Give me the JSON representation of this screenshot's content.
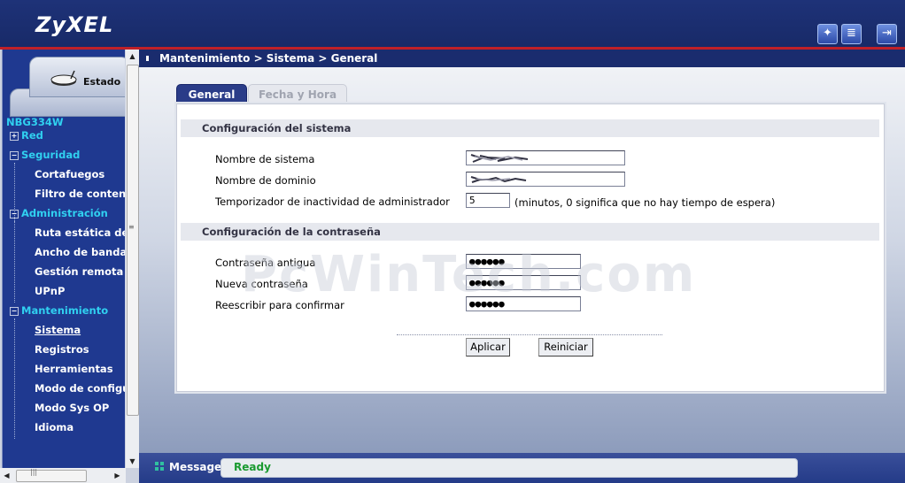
{
  "header": {
    "logo": "ZyXEL",
    "tools": [
      {
        "icon": "wizard-icon",
        "glyph": "✦"
      },
      {
        "icon": "notes-icon",
        "glyph": "≣"
      },
      {
        "icon": "logout-icon",
        "glyph": "⇥"
      }
    ]
  },
  "sidebar": {
    "tab_label": "Estado",
    "device": "NBG334W",
    "menu": [
      {
        "label": "Red",
        "type": "top",
        "sign": "+"
      },
      {
        "label": "Seguridad",
        "type": "top",
        "sign": "−"
      },
      {
        "label": "Cortafuegos",
        "type": "sub"
      },
      {
        "label": "Filtro de conten",
        "type": "sub"
      },
      {
        "label": "Administración",
        "type": "top",
        "sign": "−"
      },
      {
        "label": "Ruta estática de",
        "type": "sub"
      },
      {
        "label": "Ancho de banda",
        "type": "sub"
      },
      {
        "label": "Gestión remota",
        "type": "sub"
      },
      {
        "label": "UPnP",
        "type": "sub"
      },
      {
        "label": "Mantenimiento",
        "type": "top",
        "sign": "−"
      },
      {
        "label": "Sistema",
        "type": "sub",
        "active": true
      },
      {
        "label": "Registros",
        "type": "sub"
      },
      {
        "label": "Herramientas",
        "type": "sub"
      },
      {
        "label": "Modo de configu",
        "type": "sub"
      },
      {
        "label": "Modo Sys OP",
        "type": "sub"
      },
      {
        "label": "Idioma",
        "type": "sub"
      }
    ]
  },
  "breadcrumb": "Mantenimiento > Sistema > General",
  "tabs": [
    {
      "label": "General",
      "active": true
    },
    {
      "label": "Fecha y Hora",
      "active": false
    }
  ],
  "system_config": {
    "heading": "Configuración del sistema",
    "system_name_label": "Nombre de sistema",
    "domain_name_label": "Nombre de dominio",
    "timeout_label": "Temporizador de inactividad de administrador",
    "timeout_value": "5",
    "timeout_note": "(minutos, 0 significa que no hay tiempo de espera)"
  },
  "password_config": {
    "heading": "Configuración de la contraseña",
    "old_label": "Contraseña antigua",
    "old_value": "●●●●●●",
    "new_label": "Nueva contraseña",
    "new_value": "●●●●●●",
    "confirm_label": "Reescribir para confirmar",
    "confirm_value": "●●●●●●"
  },
  "buttons": {
    "apply": "Aplicar",
    "reset": "Reiniciar"
  },
  "watermark": "PcWinTech.com",
  "message_bar": {
    "label": "Message",
    "status": "Ready"
  },
  "colors": {
    "accent_cyan": "#30d0f0",
    "sidebar_bg": "#1f3990",
    "header_red": "#c02028",
    "status_green": "#1a9a30"
  }
}
